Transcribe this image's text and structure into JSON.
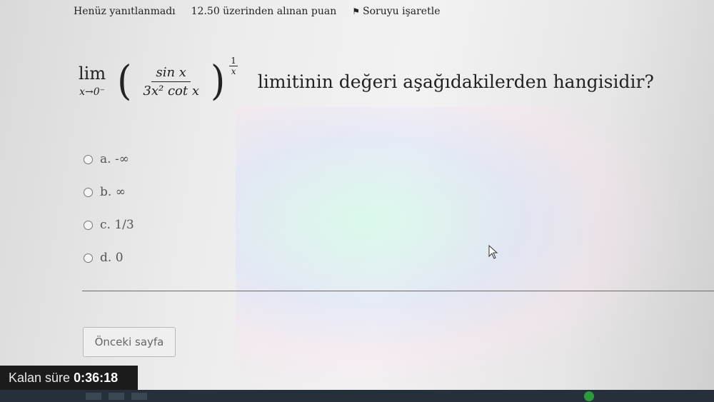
{
  "header": {
    "status": "Henüz yanıtlanmadı",
    "points": "12.50 üzerinden alınan puan",
    "flag_label": "Soruyu işaretle"
  },
  "question": {
    "lim_word": "lim",
    "lim_sub": "x→0⁻",
    "numerator": "sin x",
    "denominator": "3x² cot x",
    "power_num": "1",
    "power_den": "x",
    "text": "limitinin değeri aşağıdakilerden hangisidir?"
  },
  "options": [
    {
      "label": "a. -∞"
    },
    {
      "label": "b. ∞"
    },
    {
      "label": "c. 1/3"
    },
    {
      "label": "d. 0"
    }
  ],
  "navigation": {
    "prev_label": "Önceki sayfa"
  },
  "timer": {
    "label": "Kalan süre",
    "value": "0:36:18"
  }
}
